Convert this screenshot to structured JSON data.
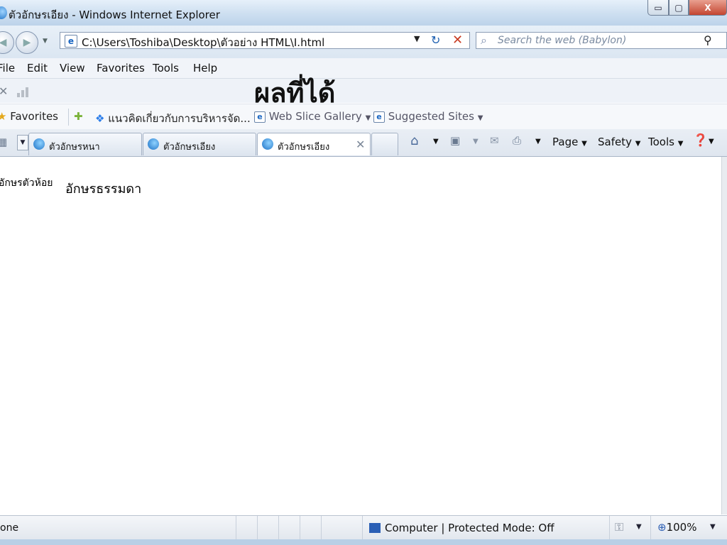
{
  "window": {
    "title": "ตัวอักษรเอียง - Windows Internet Explorer",
    "min_label": "▭",
    "max_label": "▢",
    "close_label": "X"
  },
  "nav": {
    "address_url": "C:\\Users\\Toshiba\\Desktop\\ตัวอย่าง HTML\\I.html",
    "search_placeholder": "Search the web (Babylon)"
  },
  "menu": {
    "items": [
      "File",
      "Edit",
      "View",
      "Favorites",
      "Tools",
      "Help"
    ]
  },
  "overlay_caption": "ผลที่ได้",
  "favorites_bar": {
    "favorites_label": "Favorites",
    "link1": "แนวคิดเกี่ยวกับการบริหารจัด...",
    "web_slice": "Web Slice Gallery",
    "suggested": "Suggested Sites"
  },
  "tabs": [
    {
      "label": "ตัวอักษรหนา"
    },
    {
      "label": "ตัวอักษรเอียง"
    },
    {
      "label": "ตัวอักษรเอียง"
    }
  ],
  "command_bar": {
    "page": "Page",
    "safety": "Safety",
    "tools": "Tools"
  },
  "content": {
    "small_text": "อักษรตัวห้อย",
    "normal_text": "อักษรธรรมดา"
  },
  "status": {
    "text": "one",
    "zone": "Computer | Protected Mode: Off",
    "zoom": "100%"
  },
  "icons": {
    "back": "arrow-left-icon",
    "forward": "arrow-right-icon",
    "refresh": "refresh-icon",
    "stop": "stop-icon",
    "search": "search-icon",
    "home": "home-icon",
    "feeds": "rss-icon",
    "mail": "mail-icon",
    "print": "print-icon",
    "help": "help-icon"
  }
}
